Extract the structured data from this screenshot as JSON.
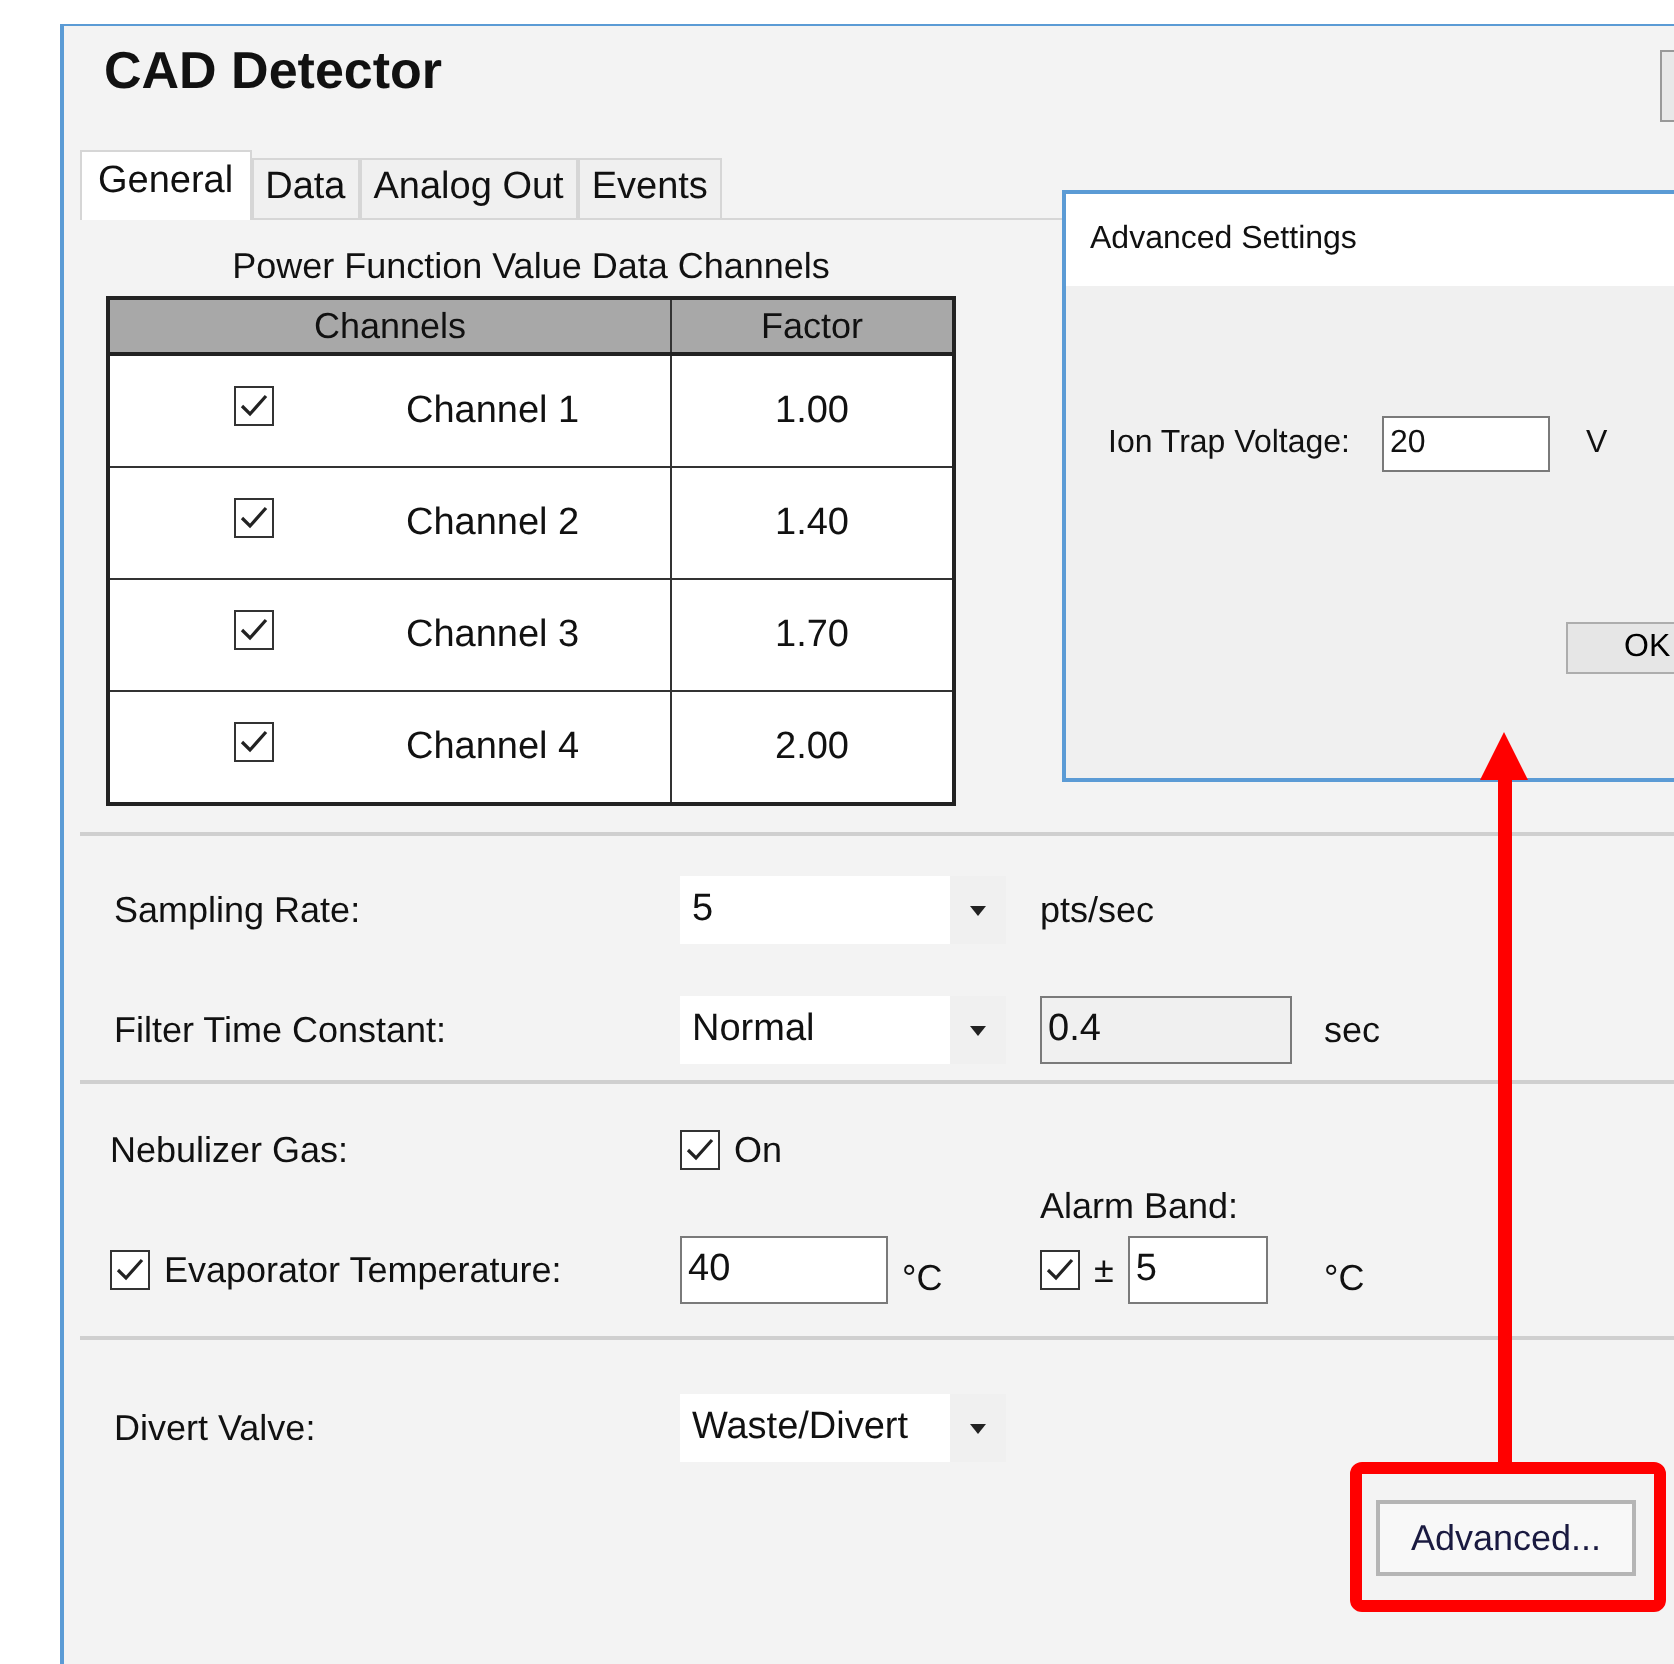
{
  "window": {
    "title": "CAD Detector"
  },
  "tabs": [
    {
      "label": "General",
      "selected": true
    },
    {
      "label": "Data",
      "selected": false
    },
    {
      "label": "Analog Out",
      "selected": false
    },
    {
      "label": "Events",
      "selected": false
    }
  ],
  "channels_table": {
    "caption": "Power Function Value Data Channels",
    "columns": [
      "Channels",
      "Factor"
    ],
    "rows": [
      {
        "checked": true,
        "channel": "Channel 1",
        "factor": "1.00"
      },
      {
        "checked": true,
        "channel": "Channel 2",
        "factor": "1.40"
      },
      {
        "checked": true,
        "channel": "Channel 3",
        "factor": "1.70"
      },
      {
        "checked": true,
        "channel": "Channel 4",
        "factor": "2.00"
      }
    ]
  },
  "sampling_rate": {
    "label": "Sampling Rate:",
    "value": "5",
    "unit": "pts/sec"
  },
  "filter_time_constant": {
    "label": "Filter Time Constant:",
    "value": "Normal",
    "readout": "0.4",
    "unit": "sec"
  },
  "nebulizer_gas": {
    "label": "Nebulizer Gas:",
    "checked": true,
    "option": "On"
  },
  "alarm_band": {
    "label": "Alarm Band:",
    "checked": true,
    "symbol": "±",
    "value": "5",
    "unit": "°C"
  },
  "evaporator_temperature": {
    "checked": true,
    "label": "Evaporator Temperature:",
    "value": "40",
    "unit": "°C"
  },
  "divert_valve": {
    "label": "Divert Valve:",
    "value": "Waste/Divert"
  },
  "advanced_button": {
    "label": "Advanced..."
  },
  "dialog": {
    "title": "Advanced Settings",
    "field_label": "Ion Trap Voltage:",
    "value": "20",
    "unit": "V",
    "ok": "OK"
  }
}
